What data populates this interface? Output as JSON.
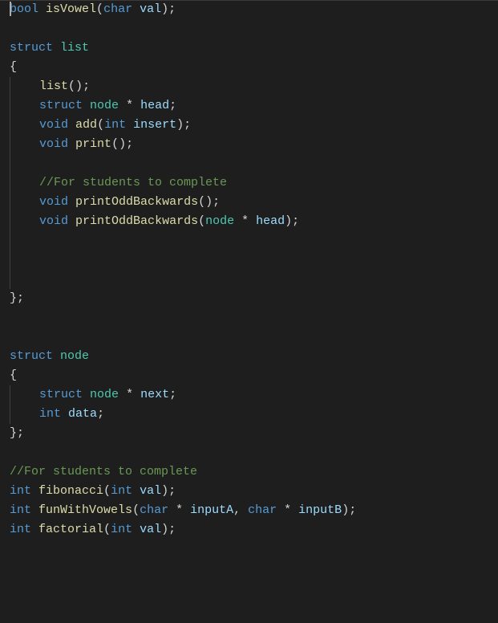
{
  "kw": {
    "bool": "bool",
    "char": "char",
    "struct": "struct",
    "void": "void",
    "int": "int"
  },
  "id": {
    "val": "val",
    "head": "head",
    "insert": "insert",
    "next": "next",
    "data": "data",
    "inputA": "inputA",
    "inputB": "inputB"
  },
  "cls": {
    "list": "list",
    "node": "node"
  },
  "fn": {
    "isVowel": "isVowel",
    "list": "list",
    "add": "add",
    "print": "print",
    "printOddBackwards": "printOddBackwards",
    "fibonacci": "fibonacci",
    "funWithVowels": "funWithVowels",
    "factorial": "factorial"
  },
  "comment": {
    "students1": "//For students to complete",
    "students2": "//For students to complete"
  },
  "sym": {
    "lparen": "(",
    "rparen": ")",
    "lbrace": "{",
    "rbrace": "}",
    "rbraceSemi": "};",
    "semi": ";",
    "star": " * ",
    "comma": ", "
  },
  "indent": "    "
}
